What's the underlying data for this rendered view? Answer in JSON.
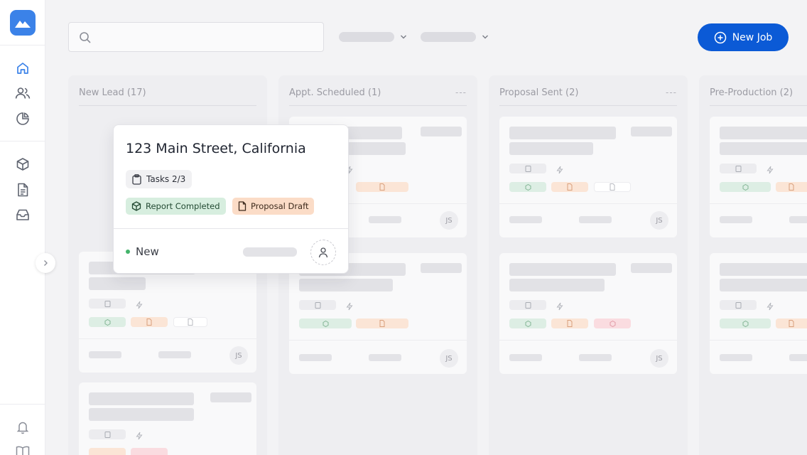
{
  "toolbar": {
    "new_job_label": "New Job",
    "search_placeholder": ""
  },
  "popup": {
    "address": "123 Main Street, California",
    "tasks": "Tasks 2/3",
    "tags": [
      "Report Completed",
      "Proposal Draft"
    ],
    "status": "New"
  },
  "columns": [
    {
      "title": "New Lead (17)",
      "more": ""
    },
    {
      "title": "Appt. Scheduled (1)",
      "more": "---"
    },
    {
      "title": "Proposal Sent (2)",
      "more": "---"
    },
    {
      "title": "Pre-Production (2)",
      "more": ""
    }
  ],
  "card_initials": "JS",
  "colors": {
    "accent": "#0b5ad6",
    "brand": "#3b82e8",
    "status_new": "#43b36b",
    "tag_green_bg": "#d7eedf",
    "tag_orange_bg": "#fbdcc7"
  },
  "sidebar_icons": [
    "home-icon",
    "users-icon",
    "pie-chart-icon",
    "box-icon",
    "document-icon",
    "inbox-icon",
    "bell-icon",
    "book-icon"
  ]
}
